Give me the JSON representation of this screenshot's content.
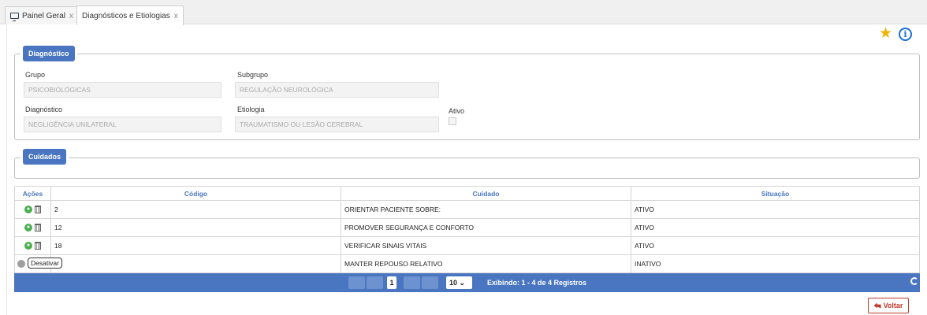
{
  "tabs": [
    {
      "label": "Painel Geral",
      "close": "x"
    },
    {
      "label": "Diagnósticos e Etiologias",
      "close": "x"
    }
  ],
  "diagnostico": {
    "legend": "Diagnóstico",
    "grupo_label": "Grupo",
    "grupo_value": "PSICOBIOLÓGICAS",
    "subgrupo_label": "Subgrupo",
    "subgrupo_value": "REGULAÇÃO NEUROLÓGICA",
    "diagnostico_label": "Diagnóstico",
    "diagnostico_value": "NEGLIGÊNCIA UNILATERAL",
    "etiologia_label": "Etiologia",
    "etiologia_value": "TRAUMATISMO OU LESÃO CEREBRAL",
    "ativo_label": "Ativo",
    "ativo_checked": false
  },
  "cuidados": {
    "legend": "Cuidados"
  },
  "table": {
    "headers": [
      "Ações",
      "Código",
      "Cuidado",
      "Situação"
    ],
    "rows": [
      {
        "codigo": "2",
        "cuidado": "ORIENTAR PACIENTE SOBRE:",
        "situacao": "ATIVO",
        "active": true
      },
      {
        "codigo": "12",
        "cuidado": "PROMOVER SEGURANÇA E CONFORTO",
        "situacao": "ATIVO",
        "active": true
      },
      {
        "codigo": "18",
        "cuidado": "VERIFICAR SINAIS VITAIS",
        "situacao": "ATIVO",
        "active": true
      },
      {
        "codigo": "",
        "cuidado": "MANTER REPOUSO RELATIVO",
        "situacao": "INATIVO",
        "active": false
      }
    ],
    "tooltip": "Desativar"
  },
  "pager": {
    "current_page": "1",
    "page_size": "10",
    "info": "Exibindo: 1 - 4 de 4 Registros"
  },
  "buttons": {
    "voltar": "Voltar"
  },
  "colors": {
    "accent": "#4a76c1",
    "star": "#f0b400",
    "info": "#1a6fd6",
    "danger": "#c0392b",
    "active_icon": "#4caf50"
  },
  "icons": [
    "monitor-icon",
    "star-icon",
    "info-icon",
    "activate-icon",
    "trash-icon",
    "refresh-icon",
    "back-arrow-icon"
  ]
}
